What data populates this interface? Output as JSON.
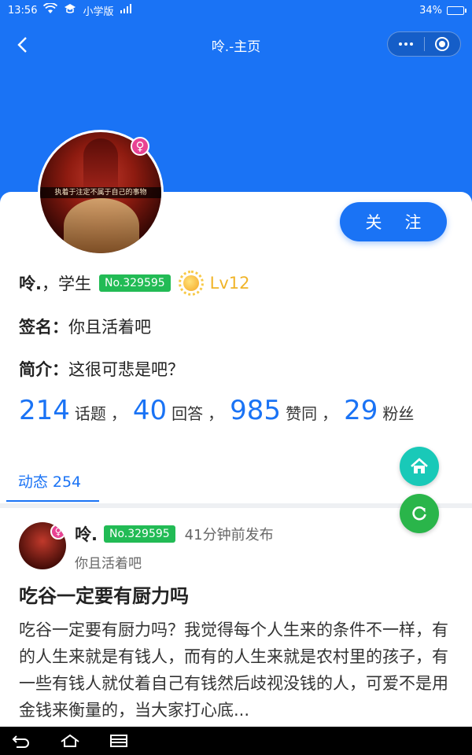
{
  "status_bar": {
    "time": "13:56",
    "app_name": "小学版",
    "battery": "34%",
    "battery_level": 0.34
  },
  "nav": {
    "title": "呤.-主页"
  },
  "profile": {
    "name": "呤.",
    "role": "，学生",
    "badge": "No.329595",
    "level": "Lv12",
    "follow_btn": {
      "left": "关",
      "right": "注"
    },
    "signature_label": "签名：",
    "signature": "你且活着吧",
    "intro_label": "简介：",
    "intro": "这很可悲是吧？",
    "avatar_caption": "执着于注定不属于自己的事物"
  },
  "stats": {
    "topics": "214",
    "topics_label": "话题",
    "answers": "40",
    "answers_label": "回答",
    "likes": "985",
    "likes_label": "赞同",
    "fans": "29",
    "fans_label": "粉丝",
    "comma": "，"
  },
  "tab": {
    "label": "动态 254"
  },
  "post": {
    "author": "呤.",
    "badge": "No.329595",
    "time": "41分钟前发布",
    "signature": "你且活着吧",
    "title": "吃谷一定要有厨力吗",
    "body": "吃谷一定要有厨力吗？我觉得每个人生来的条件不一样，有的人生来就是有钱人，而有的人生来就是农村里的孩子，有一些有钱人就仗着自己有钱然后歧视没钱的人，可爱不是用金钱来衡量的，当大家打心底..."
  },
  "colors": {
    "primary": "#1a73f5",
    "badge_green": "#22bb55",
    "level_gold": "#f0b429",
    "female_pink": "#e84393",
    "fab_home": "#19c9b8",
    "fab_refresh": "#2ab54a"
  },
  "icons": [
    "wifi-icon",
    "graduation-icon",
    "signal-icon",
    "back-icon",
    "more-icon",
    "target-icon",
    "female-icon",
    "sun-level-icon",
    "home-icon",
    "refresh-icon",
    "nav-back-icon",
    "nav-home-icon",
    "nav-recent-icon"
  ]
}
